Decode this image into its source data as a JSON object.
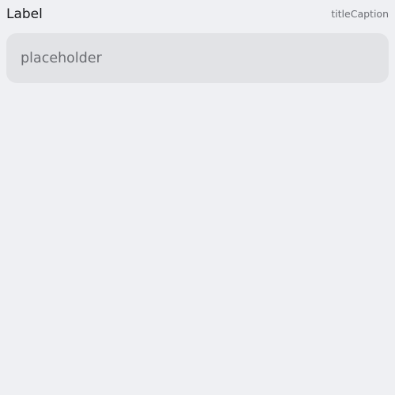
{
  "field": {
    "label": "Label",
    "caption": "titleCaption",
    "input": {
      "value": "",
      "placeholder": "placeholder"
    }
  }
}
